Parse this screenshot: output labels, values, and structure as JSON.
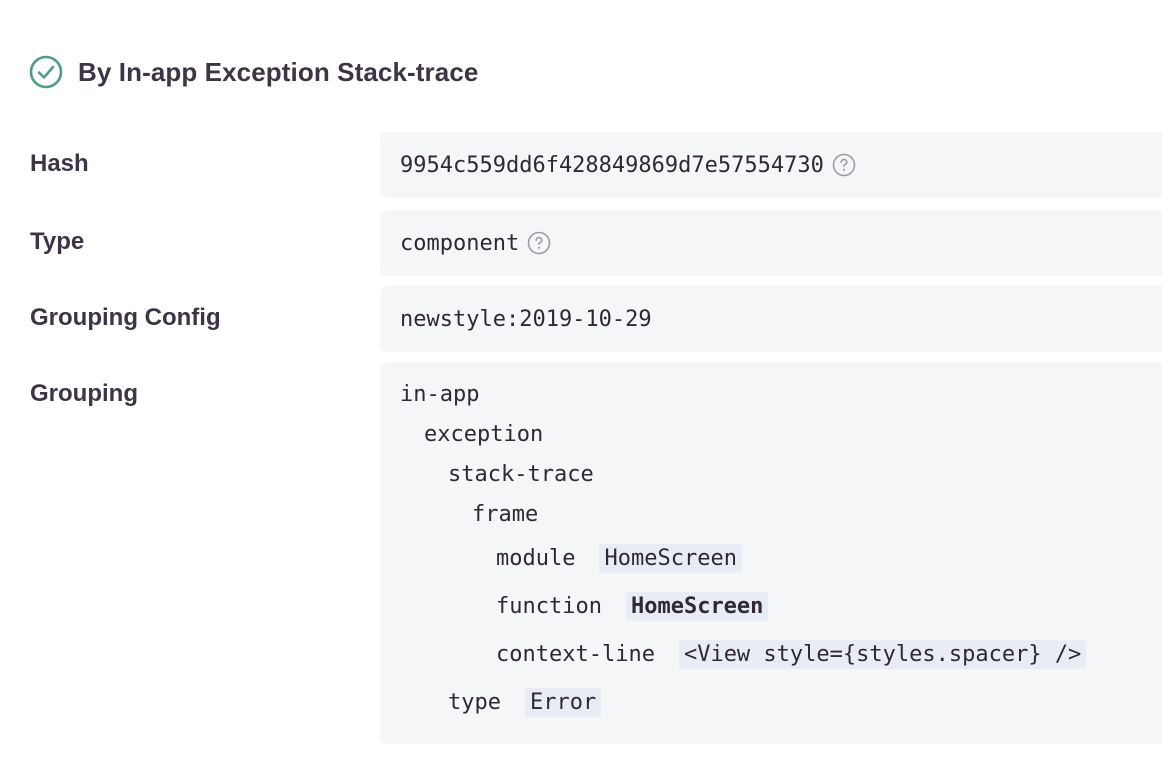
{
  "header": {
    "title": "By In-app Exception Stack-trace",
    "status_icon": "check-circle-icon",
    "status_color": "#4e9d85"
  },
  "rows": {
    "hash": {
      "label": "Hash",
      "value": "9954c559dd6f428849869d7e57554730",
      "help_icon": "question-circle-icon"
    },
    "type": {
      "label": "Type",
      "value": "component",
      "help_icon": "question-circle-icon"
    },
    "config": {
      "label": "Grouping Config",
      "value": "newstyle:2019-10-29"
    },
    "grouping": {
      "label": "Grouping",
      "tree": [
        {
          "key": "in-app"
        },
        {
          "key": "exception"
        },
        {
          "key": "stack-trace"
        },
        {
          "key": "frame"
        },
        {
          "key": "module",
          "value": "HomeScreen"
        },
        {
          "key": "function",
          "value": "HomeScreen"
        },
        {
          "key": "context-line",
          "value": "<View style={styles.spacer} />"
        },
        {
          "key": "type",
          "value": "Error"
        }
      ]
    }
  },
  "colors": {
    "box_background": "#f5f6f8",
    "value_highlight": "#e8ecf5",
    "text": "#2f2936",
    "help_icon": "#9c9aa3"
  }
}
